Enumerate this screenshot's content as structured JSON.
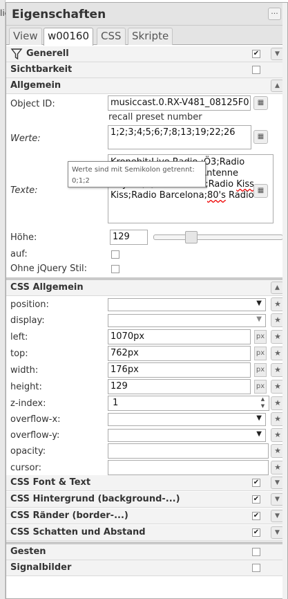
{
  "edge_fragment": "lic",
  "title": "Eigenschaften",
  "tabs": [
    "View",
    "w00160",
    "CSS",
    "Skripte"
  ],
  "sections": {
    "generell": "Generell",
    "sichtbarkeit": "Sichtbarkeit",
    "allgemein": "Allgemein",
    "css_allgemein": "CSS Allgemein",
    "css_font": "CSS Font & Text",
    "css_hintergrund": "CSS Hintergrund (background-...)",
    "css_raender": "CSS Ränder (border-...)",
    "css_schatten": "CSS Schatten und Abstand",
    "gesten": "Gesten",
    "signalbilder": "Signalbilder"
  },
  "checks": {
    "generell": true,
    "sichtbarkeit": false,
    "css_font": true,
    "css_hintergrund": true,
    "css_raender": true,
    "css_schatten": true,
    "gesten": false,
    "signalbilder": false
  },
  "allgemein": {
    "object_id_label": "Object ID:",
    "object_id_value": "musiccast.0.RX-V481_08125F0",
    "object_id_hint": "recall preset number",
    "werte_label": "Werte:",
    "werte_value": "1;2;3;4;5;6;7;8;13;19;22;26",
    "texte_label": "Texte:",
    "texte_line1": "Kronehit;Live Radio ;Ö3;Radio",
    "texte_line2": "Kiss;Radio Paradise;Antenne",
    "texte_line3a": "Bayern;8;Club Sound;Radio ",
    "texte_line3b": "Kiss",
    "texte_line4a": "Kiss;Radio Barcelona;",
    "texte_line4b": "80's",
    "texte_line4c": " Radio",
    "hoehe_label": "Höhe:",
    "hoehe_value": "129",
    "hoehe_slider_fraction": 0.27,
    "auf_label": "auf:",
    "ohne_jquery_label": "Ohne jQuery Stil:"
  },
  "tooltip": {
    "line1": "Werte sind mit Semikolon getrennt:",
    "line2": "0;1;2"
  },
  "css": {
    "position_label": "position:",
    "display_label": "display:",
    "left_label": "left:",
    "left_value": "1070px",
    "top_label": "top:",
    "top_value": "762px",
    "width_label": "width:",
    "width_value": "176px",
    "height_label": "height:",
    "height_value": "129",
    "zindex_label": "z-index:",
    "zindex_value": "1",
    "overflowx_label": "overflow-x:",
    "overflowy_label": "overflow-y:",
    "opacity_label": "opacity:",
    "cursor_label": "cursor:",
    "unit": "px"
  },
  "icons": {
    "filter": "filter-icon",
    "star": "star-icon",
    "object_picker": "object-picker-icon",
    "caret": "chevron-down-icon",
    "collapse": "chevron-up-icon"
  }
}
